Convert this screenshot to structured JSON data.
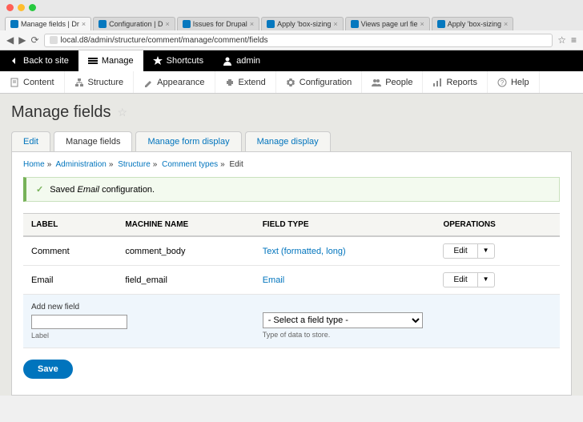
{
  "browser": {
    "tabs": [
      {
        "label": "Manage fields | Dr",
        "active": true
      },
      {
        "label": "Configuration | D"
      },
      {
        "label": "Issues for Drupal"
      },
      {
        "label": "Apply 'box-sizing"
      },
      {
        "label": "Views page url fie"
      },
      {
        "label": "Apply 'box-sizing"
      }
    ],
    "url": "local.d8/admin/structure/comment/manage/comment/fields"
  },
  "toolbar": {
    "back": "Back to site",
    "manage": "Manage",
    "shortcuts": "Shortcuts",
    "admin": "admin"
  },
  "admin_menu": {
    "content": "Content",
    "structure": "Structure",
    "appearance": "Appearance",
    "extend": "Extend",
    "configuration": "Configuration",
    "people": "People",
    "reports": "Reports",
    "help": "Help"
  },
  "page": {
    "title": "Manage fields"
  },
  "tabs": {
    "edit": "Edit",
    "manage_fields": "Manage fields",
    "manage_form": "Manage form display",
    "manage_display": "Manage display"
  },
  "breadcrumb": {
    "home": "Home",
    "admin": "Administration",
    "structure": "Structure",
    "comment_types": "Comment types",
    "edit": "Edit"
  },
  "status": {
    "prefix": "Saved",
    "em": "Email",
    "suffix": "configuration."
  },
  "table": {
    "headers": {
      "label": "LABEL",
      "machine": "MACHINE NAME",
      "type": "FIELD TYPE",
      "ops": "OPERATIONS"
    },
    "rows": [
      {
        "label": "Comment",
        "machine": "comment_body",
        "type": "Text (formatted, long)",
        "op": "Edit"
      },
      {
        "label": "Email",
        "machine": "field_email",
        "type": "Email",
        "op": "Edit"
      }
    ]
  },
  "add": {
    "title": "Add new field",
    "label_hint": "Label",
    "select_placeholder": "- Select a field type -",
    "type_hint": "Type of data to store."
  },
  "save": "Save"
}
